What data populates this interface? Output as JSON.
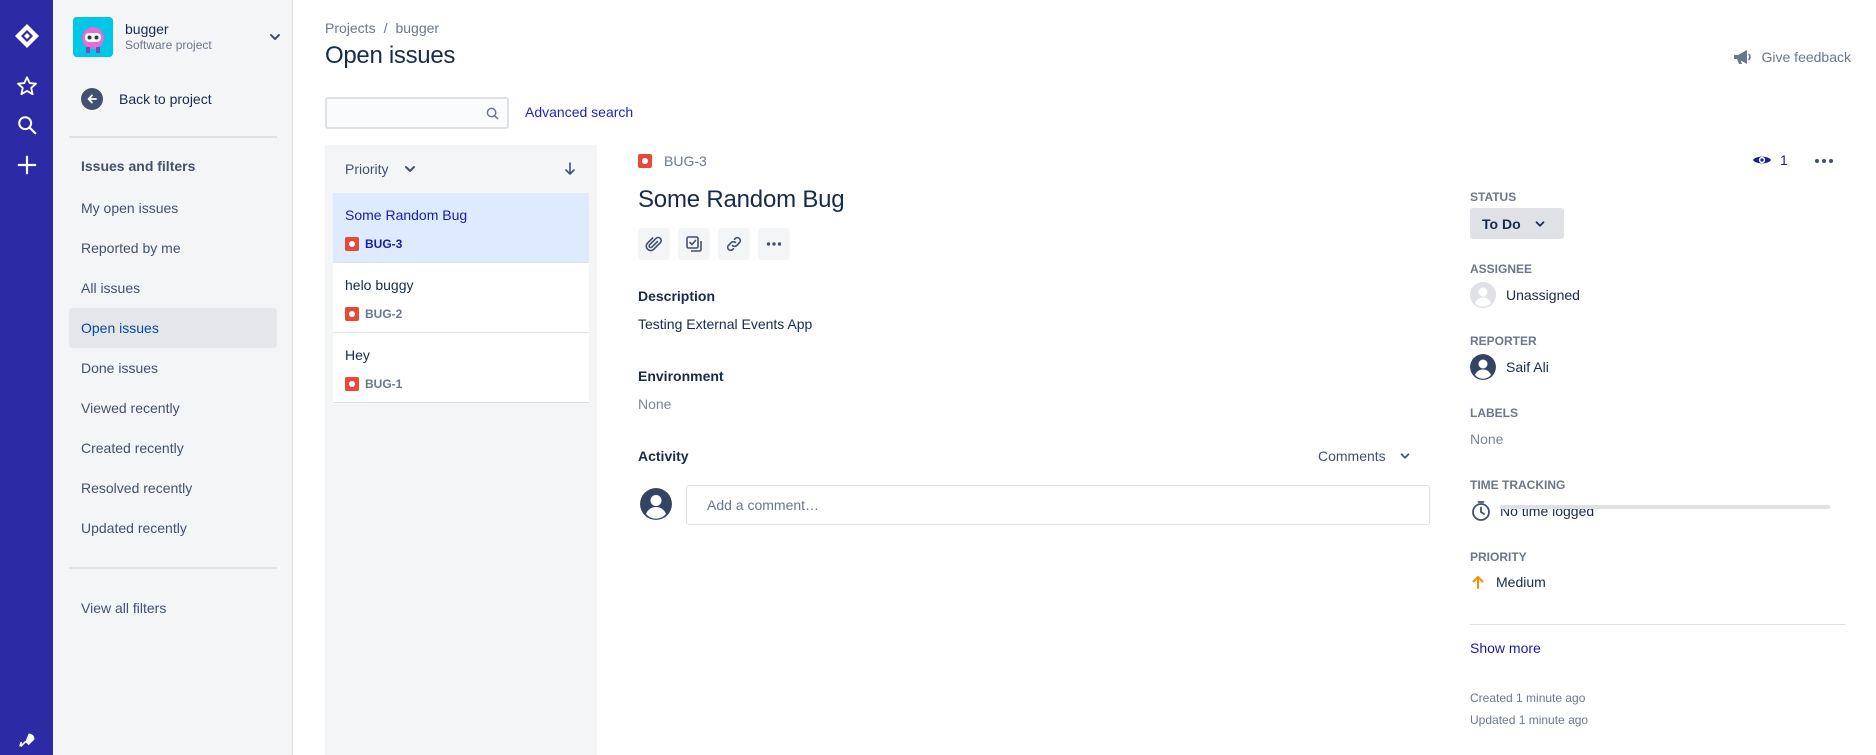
{
  "project": {
    "name": "bugger",
    "type": "Software project",
    "back_label": "Back to project"
  },
  "sidebar": {
    "section_title": "Issues and filters",
    "items": [
      {
        "label": "My open issues"
      },
      {
        "label": "Reported by me"
      },
      {
        "label": "All issues"
      },
      {
        "label": "Open issues",
        "active": true
      },
      {
        "label": "Done issues"
      },
      {
        "label": "Viewed recently"
      },
      {
        "label": "Created recently"
      },
      {
        "label": "Resolved recently"
      },
      {
        "label": "Updated recently"
      }
    ],
    "view_all_filters": "View all filters"
  },
  "header": {
    "breadcrumb": [
      "Projects",
      "bugger"
    ],
    "breadcrumb_sep": "/",
    "title": "Open issues",
    "feedback_label": "Give feedback"
  },
  "search": {
    "value": "",
    "placeholder": "",
    "advanced_label": "Advanced search"
  },
  "issue_list": {
    "sort_label": "Priority",
    "issues": [
      {
        "title": "Some Random Bug",
        "key": "BUG-3",
        "selected": true
      },
      {
        "title": "helo buggy",
        "key": "BUG-2",
        "selected": false
      },
      {
        "title": "Hey",
        "key": "BUG-1",
        "selected": false
      }
    ]
  },
  "detail": {
    "key": "BUG-3",
    "watchers": "1",
    "title": "Some Random Bug",
    "description_label": "Description",
    "description": "Testing External Events App",
    "environment_label": "Environment",
    "environment": "None",
    "activity_label": "Activity",
    "activity_filter": "Comments",
    "comment_placeholder": "Add a comment…"
  },
  "fields": {
    "status_label": "STATUS",
    "status": "To Do",
    "assignee_label": "ASSIGNEE",
    "assignee": "Unassigned",
    "reporter_label": "REPORTER",
    "reporter": "Saif Ali",
    "labels_label": "LABELS",
    "labels": "None",
    "time_tracking_label": "TIME TRACKING",
    "time_tracking": "No time logged",
    "priority_label": "PRIORITY",
    "priority": "Medium",
    "show_more": "Show more",
    "created": "Created 1 minute ago",
    "updated": "Updated 1 minute ago"
  },
  "colors": {
    "rail": "#2c2ba5",
    "bug": "#e5493a",
    "link": "#1a1aa5",
    "priority_medium": "#ff8b00"
  }
}
